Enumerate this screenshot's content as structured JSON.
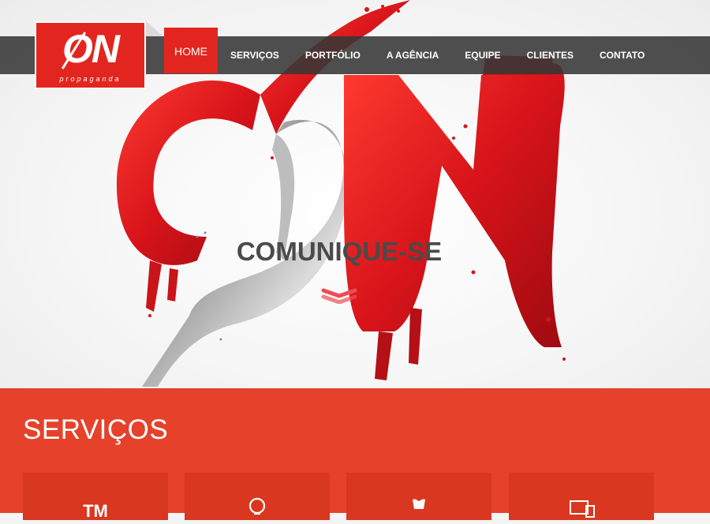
{
  "logo": {
    "main": "ON",
    "sub": "propaganda"
  },
  "nav": {
    "items": [
      {
        "label": "HOME",
        "active": true
      },
      {
        "label": "SERVIÇOS",
        "active": false
      },
      {
        "label": "PORTFÓLIO",
        "active": false
      },
      {
        "label": "A AGÊNCIA",
        "active": false
      },
      {
        "label": "EQUIPE",
        "active": false
      },
      {
        "label": "CLIENTES",
        "active": false
      },
      {
        "label": "CONTATO",
        "active": false
      }
    ]
  },
  "hero": {
    "title": "COMUNIQUE-SE",
    "arrow_icon": "chevron-down-icon"
  },
  "services": {
    "title": "SERVIÇOS",
    "cards": [
      {
        "icon": "trademark-icon",
        "glyph": "TM"
      },
      {
        "icon": "lightbulb-icon"
      },
      {
        "icon": "hand-icon"
      },
      {
        "icon": "devices-icon"
      }
    ]
  },
  "colors": {
    "brand_red": "#e2261f",
    "services_bg": "#e6412a",
    "card_bg": "#d9371f",
    "nav_bg": "#373737"
  }
}
